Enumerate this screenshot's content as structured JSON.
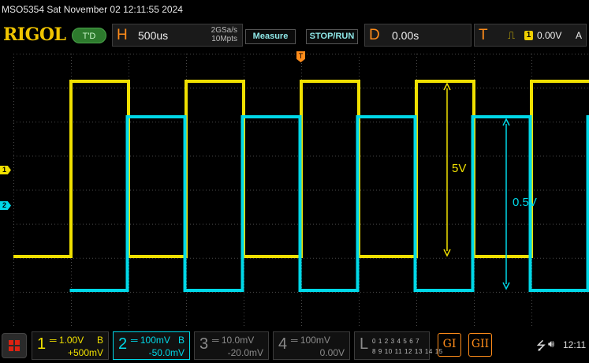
{
  "status": {
    "device_info": "MSO5354  Sat November 02 12:11:55 2024"
  },
  "toolbar": {
    "logo": "RIGOL",
    "run_state": "T'D",
    "horizontal": {
      "key": "H",
      "timebase": "500us",
      "sample_rate": "2GSa/s",
      "memory_depth": "10Mpts"
    },
    "measure_label": "Measure",
    "stoprun_label": "STOP/RUN",
    "delay": {
      "key": "D",
      "value": "0.00s"
    },
    "trigger": {
      "key": "T",
      "edge_icon": "rising-edge-icon",
      "source": "1",
      "level": "0.00V",
      "mode": "A"
    }
  },
  "markers": {
    "ch1": "1",
    "ch2": "2",
    "trigger_position": "T"
  },
  "waveforms": {
    "ch1_color": "#f0e000",
    "ch2_color": "#00d8e8",
    "grid_color": "#4a4a4a",
    "ch1": {
      "high_v": 5.0,
      "low_v": 0.0,
      "period_us": 1000,
      "duty": 0.5
    },
    "ch2": {
      "high_v": 0.5,
      "low_v": 0.0,
      "period_us": 1000,
      "duty": 0.5
    }
  },
  "annotations": {
    "ch1_amplitude": "5V",
    "ch2_amplitude": "0.5V"
  },
  "channels": [
    {
      "num": "1",
      "scale": "1.00V",
      "coupling": "B",
      "offset": "+500mV"
    },
    {
      "num": "2",
      "scale": "100mV",
      "coupling": "B",
      "offset": "-50.0mV"
    },
    {
      "num": "3",
      "scale": "10.0mV",
      "offset": "-20.0mV"
    },
    {
      "num": "4",
      "scale": "100mV",
      "offset": "0.00V"
    }
  ],
  "logic": {
    "label": "L",
    "row1": "0 1 2 3  4 5 6 7",
    "row2": "8 9 10 11 12 13 14 15"
  },
  "generators": {
    "gen1": "GI",
    "gen2": "GII"
  },
  "system": {
    "clock": "12:11"
  }
}
